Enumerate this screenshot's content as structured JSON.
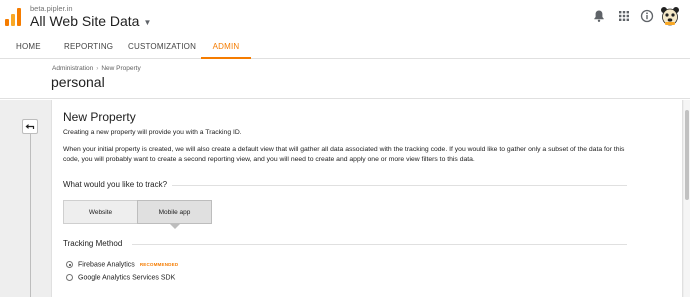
{
  "header": {
    "site_url": "beta.pipler.in",
    "site_title": "All Web Site Data"
  },
  "icons": {
    "logo": "analytics-logo-icon",
    "notifications": "bell-icon",
    "apps": "apps-grid-icon",
    "help": "help-icon",
    "avatar": "avatar-icon"
  },
  "nav": {
    "tabs": [
      {
        "label": "HOME"
      },
      {
        "label": "REPORTING"
      },
      {
        "label": "CUSTOMIZATION"
      },
      {
        "label": "ADMIN",
        "active": true
      }
    ]
  },
  "page": {
    "breadcrumb": [
      "Administration",
      "New Property"
    ],
    "account_name": "personal"
  },
  "card": {
    "title": "New Property",
    "intro": "Creating a new property will provide you with a Tracking ID.",
    "description": "When your initial property is created, we will also create a default view that will gather all data associated with the tracking code. If you would like to gather only a subset of the data for this code, you will probably want to create a second reporting view, and you will need to create and apply one or more view filters to this data.",
    "track_question": "What would you like to track?",
    "track_options": [
      "Website",
      "Mobile app"
    ],
    "track_selected": "Mobile app",
    "tracking_method_label": "Tracking Method",
    "methods": [
      {
        "label": "Firebase Analytics",
        "badge": "RECOMMENDED",
        "selected": true
      },
      {
        "label": "Google Analytics Services SDK",
        "selected": false
      }
    ]
  },
  "colors": {
    "accent": "#f57c00",
    "logo": "#f57c00"
  }
}
